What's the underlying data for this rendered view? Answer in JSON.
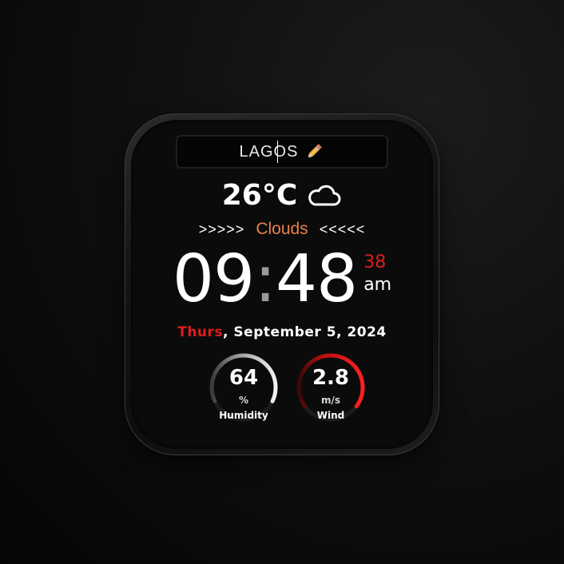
{
  "city": {
    "name": "LAGOS",
    "edit_icon": "pencil-icon"
  },
  "weather": {
    "temperature": "26°C",
    "icon": "cloud-icon",
    "arrows_left": ">>>>>",
    "condition": "Clouds",
    "arrows_right": "<<<<<",
    "condition_color": "#e8804a"
  },
  "clock": {
    "hours": "09",
    "separator": ":",
    "minutes": "48",
    "seconds": "38",
    "ampm": "am",
    "seconds_color": "#e01c1c"
  },
  "date": {
    "day": "Thurs",
    "rest": ", September 5, 2024",
    "day_color": "#e01c1c"
  },
  "humidity": {
    "value": "64",
    "unit": "%",
    "label": "Humidity",
    "fraction": 0.64,
    "color": "#cfcfcf"
  },
  "wind": {
    "value": "2.8",
    "unit": "m/s",
    "label": "Wind",
    "fraction": 0.7,
    "color": "#e01c1c"
  }
}
